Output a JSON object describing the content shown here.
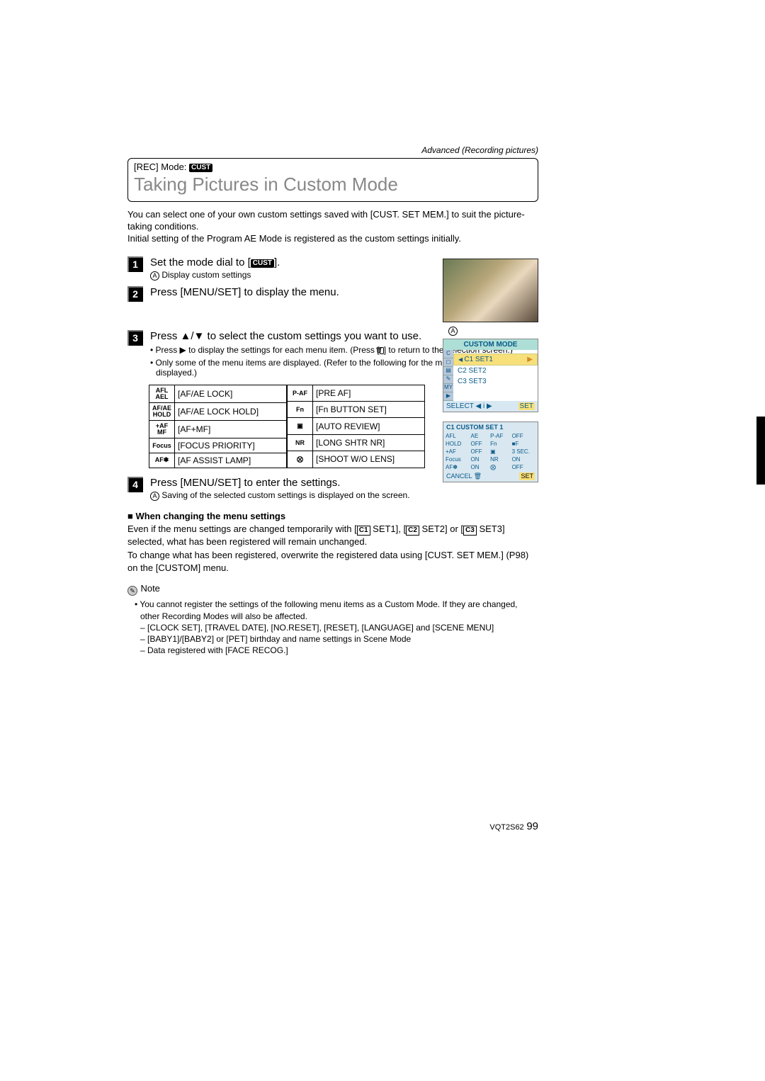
{
  "breadcrumb": "Advanced (Recording pictures)",
  "rec_mode_label": "[REC] Mode:",
  "cust_badge": "CUST",
  "title": "Taking Pictures in Custom Mode",
  "intro": "You can select one of your own custom settings saved with [CUST. SET MEM.] to suit the picture-taking conditions.\nInitial setting of the Program AE Mode is registered as the custom settings initially.",
  "steps": {
    "1": {
      "text_prefix": "Set the mode dial to [",
      "text_suffix": "].",
      "sub_label": "Display custom settings"
    },
    "2": {
      "text": "Press [MENU/SET] to display the menu."
    },
    "3": {
      "text": "Press ▲/▼ to select the custom settings you want to use.",
      "b1_prefix": "• Press ▶ to display the settings for each menu item. (Press [",
      "b1_suffix": "] to return to the selection screen.)",
      "b2": "• Only some of the menu items are displayed. (Refer to the following for the menu items that are displayed.)"
    },
    "4": {
      "text": "Press [MENU/SET] to enter the settings.",
      "sub": "Saving of the selected custom settings is displayed on the screen."
    }
  },
  "menu_table": {
    "left": [
      {
        "icon": "AFL\nAEL",
        "label": "[AF/AE LOCK]"
      },
      {
        "icon": "AF/AE\nHOLD",
        "label": "[AF/AE LOCK HOLD]"
      },
      {
        "icon": "+AF\nMF",
        "label": "[AF+MF]"
      },
      {
        "icon": "Focus",
        "label": "[FOCUS PRIORITY]"
      },
      {
        "icon": "AF✽",
        "label": "[AF ASSIST LAMP]"
      }
    ],
    "right": [
      {
        "icon": "P-AF",
        "label": "[PRE AF]"
      },
      {
        "icon": "Fn",
        "label": "[Fn BUTTON SET]"
      },
      {
        "icon": "▣",
        "label": "[AUTO REVIEW]"
      },
      {
        "icon": "NR",
        "label": "[LONG SHTR NR]"
      },
      {
        "icon": "⨂",
        "label": "[SHOOT W/O LENS]"
      }
    ]
  },
  "marker_a": "A",
  "menu1": {
    "title": "CUSTOM MODE",
    "items": [
      "C1 SET1",
      "C2 SET2",
      "C3 SET3"
    ],
    "footer_left": "SELECT ◀  i  ▶",
    "footer_right": "SET"
  },
  "menu2": {
    "title": "C1 CUSTOM SET 1",
    "rows": [
      [
        "AFL",
        "AE",
        "P-AF",
        "OFF"
      ],
      [
        "HOLD",
        "OFF",
        "Fn",
        "■F"
      ],
      [
        "+AF",
        "OFF",
        "▣",
        "3 SEC."
      ],
      [
        "Focus",
        "ON",
        "NR",
        "ON"
      ],
      [
        "AF✽",
        "ON",
        "⨂",
        "OFF"
      ]
    ],
    "footer_left": "CANCEL 🗑",
    "footer_right": "SET"
  },
  "changing": {
    "heading": "■ When changing the menu settings",
    "line1_a": "Even if the menu settings are changed temporarily with [",
    "c1": "C1",
    "line1_b": " SET1], [",
    "c2": "C2",
    "line1_c": " SET2] or [",
    "c3": "C3",
    "line1_d": " SET3] selected, what has been registered will remain unchanged.",
    "line2": "To change what has been registered, overwrite the registered data using [CUST. SET MEM.] (P98) on the [CUSTOM] menu."
  },
  "note": {
    "heading": "Note",
    "b1": "• You cannot register the settings of the following menu items as a Custom Mode. If they are changed, other Recording Modes will also be affected.",
    "d1": "– [CLOCK SET], [TRAVEL DATE], [NO.RESET], [RESET], [LANGUAGE] and [SCENE MENU]",
    "d2": "– [BABY1]/[BABY2] or [PET] birthday and name settings in Scene Mode",
    "d3": "– Data registered with [FACE RECOG.]"
  },
  "footer_code": "VQT2S62",
  "footer_page": "99"
}
